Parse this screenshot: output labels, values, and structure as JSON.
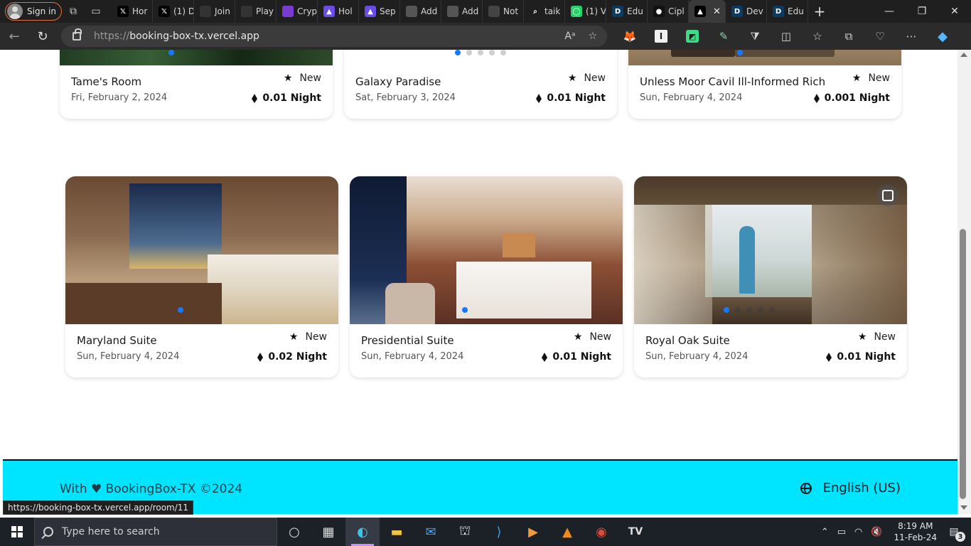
{
  "browser": {
    "signin_label": "Sign in",
    "tabs": [
      {
        "label": "Hor",
        "icon": "x-icon",
        "color": "#000000"
      },
      {
        "label": "(1) D",
        "icon": "x-icon",
        "color": "#000000"
      },
      {
        "label": "Join",
        "icon": "globe-slash-icon",
        "color": "#333333"
      },
      {
        "label": "Play",
        "icon": "globe-slash-icon",
        "color": "#333333"
      },
      {
        "label": "Cryp",
        "icon": "grid-icon",
        "color": "#7a3bd1"
      },
      {
        "label": "Hol",
        "icon": "triangle-icon",
        "color": "#6b4de6"
      },
      {
        "label": "Sep",
        "icon": "triangle-icon",
        "color": "#6b4de6"
      },
      {
        "label": "Add",
        "icon": "chart-icon",
        "color": "#555555"
      },
      {
        "label": "Add",
        "icon": "chart-icon",
        "color": "#555555"
      },
      {
        "label": "Not",
        "icon": "notion-icon",
        "color": "#444444"
      },
      {
        "label": "taik",
        "icon": "search-icon",
        "color": "#1f1f1f"
      },
      {
        "label": "(1) V",
        "icon": "whatsapp-icon",
        "color": "#25d366"
      },
      {
        "label": "Edu",
        "icon": "d-icon",
        "color": "#0b3a63"
      },
      {
        "label": "Cipl",
        "icon": "github-icon",
        "color": "#111111"
      },
      {
        "label": "",
        "icon": "triangle-icon",
        "color": "#000000",
        "active": true
      },
      {
        "label": "Dev",
        "icon": "d-icon",
        "color": "#0b3a63"
      },
      {
        "label": "Edu",
        "icon": "d-icon",
        "color": "#0b3a63"
      }
    ],
    "address": {
      "protocol": "https://",
      "host": "booking-box-tx.vercel.app"
    },
    "status_url": "https://booking-box-tx.vercel.app/room/11"
  },
  "listings": [
    {
      "name": "Tame's Room",
      "badge": "New",
      "date": "Fri, February 2, 2024",
      "price": "0.01 Night",
      "slides": 1,
      "active_slide": 0,
      "photo_theme": "forest"
    },
    {
      "name": "Galaxy Paradise",
      "badge": "New",
      "date": "Sat, February 3, 2024",
      "price": "0.01 Night",
      "slides": 5,
      "active_slide": 0,
      "photo_theme": "none"
    },
    {
      "name": "Unless Moor Cavil Ill-Informed Rich",
      "badge": "New",
      "date": "Sun, February 4, 2024",
      "price": "0.001 Night",
      "slides": 1,
      "active_slide": 0,
      "photo_theme": "desert"
    },
    {
      "name": "Maryland Suite",
      "badge": "New",
      "date": "Sun, February 4, 2024",
      "price": "0.02 Night",
      "slides": 1,
      "active_slide": 0,
      "photo_theme": "city"
    },
    {
      "name": "Presidential Suite",
      "badge": "New",
      "date": "Sun, February 4, 2024",
      "price": "0.01 Night",
      "slides": 1,
      "active_slide": 0,
      "photo_theme": "suite"
    },
    {
      "name": "Royal Oak Suite",
      "badge": "New",
      "date": "Sun, February 4, 2024",
      "price": "0.01 Night",
      "slides": 5,
      "active_slide": 0,
      "photo_theme": "tropical"
    }
  ],
  "footer": {
    "credit": "With ♥ BookingBox-TX ©2024",
    "language": "English (US)"
  },
  "taskbar": {
    "search_placeholder": "Type here to search",
    "time": "8:19 AM",
    "date": "11-Feb-24",
    "notification_count": "3"
  },
  "colors": {
    "accent_blue": "#1677ff",
    "footer_bg": "#00e5ff"
  }
}
